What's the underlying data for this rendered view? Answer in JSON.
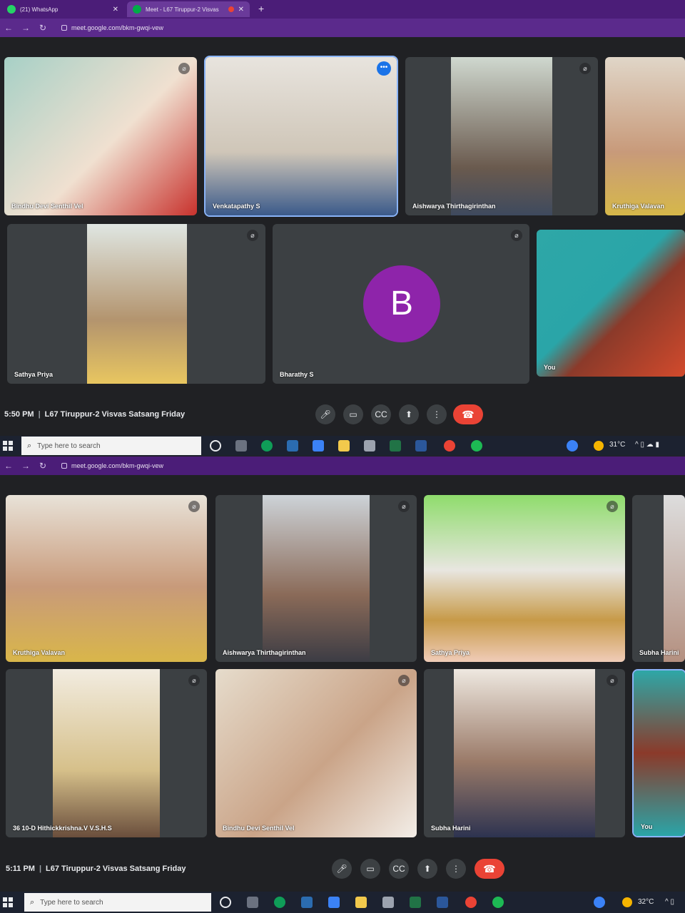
{
  "screens": [
    {
      "tabs": [
        {
          "label": "(21) WhatsApp",
          "icon": "whatsapp-icon"
        },
        {
          "label": "Meet - L67 Tiruppur-2 Visvas",
          "icon": "meet-icon"
        }
      ],
      "url": "meet.google.com/bkm-gwqi-vew",
      "participants": [
        {
          "name": "Bindhu Devi Senthil Vel"
        },
        {
          "name": "Venkatapathy S"
        },
        {
          "name": "Aishwarya Thirthagirinthan"
        },
        {
          "name": "Kruthiga Valavan"
        },
        {
          "name": "Sathya Priya"
        },
        {
          "name": "Bharathy S",
          "avatar_letter": "B"
        },
        {
          "name": "You"
        }
      ],
      "time": "5:50 PM",
      "meeting_title": "L67 Tiruppur-2 Visvas Satsang Friday",
      "taskbar": {
        "search_placeholder": "Type here to search",
        "temperature": "31°C"
      }
    },
    {
      "url": "meet.google.com/bkm-gwqi-vew",
      "participants": [
        {
          "name": "Kruthiga Valavan"
        },
        {
          "name": "Aishwarya Thirthagirinthan"
        },
        {
          "name": "Sathya Priya"
        },
        {
          "name": "Subha Harini"
        },
        {
          "name": "36 10-D Hithickkrishna.V V.S.H.S"
        },
        {
          "name": "Bindhu Devi Senthil Vel"
        },
        {
          "name": "Subha Harini"
        },
        {
          "name": "You"
        }
      ],
      "time": "5:11 PM",
      "meeting_title": "L67 Tiruppur-2 Visvas Satsang Friday",
      "taskbar": {
        "search_placeholder": "Type here to search",
        "temperature": "32°C"
      }
    }
  ],
  "colors": {
    "browser_frame": "#4b1d78",
    "meet_bg": "#202124",
    "tile_bg": "#3c4043",
    "end_call": "#ea4335",
    "avatar_b": "#8e24aa",
    "speaking_outline": "#8ab4f8"
  }
}
